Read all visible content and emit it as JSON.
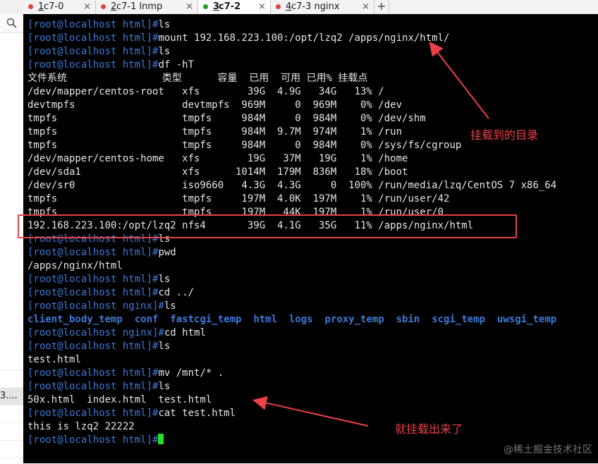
{
  "tabs": [
    {
      "num": "1",
      "name": " c7-0",
      "dot": "#e0463e",
      "close": "×"
    },
    {
      "num": "2",
      "name": " c7-1 lnmp",
      "dot": "#e0463e",
      "close": "×"
    },
    {
      "num": "3",
      "name": " c7-2",
      "dot": "#1ea11e",
      "close": "×"
    },
    {
      "num": "4",
      "name": " c7-3 nginx",
      "dot": "#e0463e",
      "close": "×"
    }
  ],
  "add_tab": "+",
  "left_panel": {
    "row_text": "3...."
  },
  "terminal": {
    "lines": [
      {
        "prompt": "[root@localhost html]#",
        "text": "ls"
      },
      {
        "prompt": "[root@localhost html]#",
        "text": "mount 192.168.223.100:/opt/lzq2 /apps/nginx/html/"
      },
      {
        "prompt": "[root@localhost html]#",
        "text": "ls"
      },
      {
        "prompt": "[root@localhost html]#",
        "text": "df -hT"
      },
      {
        "text": "文件系统                类型      容量  已用  可用 已用% 挂载点"
      },
      {
        "text": "/dev/mapper/centos-root   xfs        39G  4.9G   34G   13% /"
      },
      {
        "text": "devtmpfs                  devtmpfs  969M     0  969M    0% /dev"
      },
      {
        "text": "tmpfs                     tmpfs     984M     0  984M    0% /dev/shm"
      },
      {
        "text": "tmpfs                     tmpfs     984M  9.7M  974M    1% /run"
      },
      {
        "text": "tmpfs                     tmpfs     984M     0  984M    0% /sys/fs/cgroup"
      },
      {
        "text": "/dev/mapper/centos-home   xfs        19G   37M   19G    1% /home"
      },
      {
        "text": "/dev/sda1                 xfs      1014M  179M  836M   18% /boot"
      },
      {
        "text": "/dev/sr0                  iso9660   4.3G  4.3G     0  100% /run/media/lzq/CentOS 7 x86_64"
      },
      {
        "text": "tmpfs                     tmpfs     197M  4.0K  197M    1% /run/user/42"
      },
      {
        "text": "tmpfs                     tmpfs     197M   44K  197M    1% /run/user/0"
      },
      {
        "text": "192.168.223.100:/opt/lzq2 nfs4       39G  4.1G   35G   11% /apps/nginx/html"
      },
      {
        "prompt": "[root@localhost html]#",
        "text": "ls"
      },
      {
        "prompt": "[root@localhost html]#",
        "text": "pwd"
      },
      {
        "text": "/apps/nginx/html"
      },
      {
        "prompt": "[root@localhost html]#",
        "text": "ls"
      },
      {
        "prompt": "[root@localhost html]#",
        "text": "cd ../"
      },
      {
        "prompt": "[root@localhost nginx]#",
        "text": "ls"
      },
      {
        "dirs": [
          "client_body_temp",
          "conf",
          "fastcgi_temp",
          "html",
          "logs",
          "proxy_temp",
          "sbin",
          "scgi_temp",
          "uwsgi_temp"
        ]
      },
      {
        "prompt": "[root@localhost nginx]#",
        "text": "cd html"
      },
      {
        "prompt": "[root@localhost html]#",
        "text": "ls"
      },
      {
        "text": "test.html"
      },
      {
        "prompt": "[root@localhost html]#",
        "text": "mv /mnt/* ."
      },
      {
        "prompt": "[root@localhost html]#",
        "text": "ls"
      },
      {
        "text": "50x.html  index.html  test.html"
      },
      {
        "prompt": "[root@localhost html]#",
        "text": "cat test.html"
      },
      {
        "text": "this is lzq2 22222"
      },
      {
        "prompt": "[root@localhost html]#",
        "text": "",
        "cursor": true
      }
    ]
  },
  "annotations": {
    "mount_dir": "挂载到的目录",
    "mounted_out": "就挂载出来了"
  },
  "watermark": "@稀土掘金技术社区",
  "colors": {
    "prompt": "#3d79d6",
    "annotation": "#ee4048",
    "cursor": "#22e022",
    "terminal_bg": "#000000"
  }
}
